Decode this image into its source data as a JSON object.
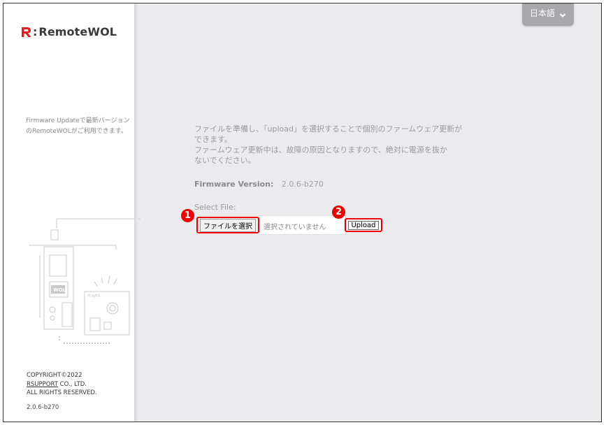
{
  "app": {
    "brand_name": "RemoteWOL"
  },
  "header": {
    "language_label": "日本語",
    "language_icon": "chevron-down-icon"
  },
  "sidebar": {
    "description": "Firmware Updateで最新バージョンのRemoteWOLがご利用できます。",
    "copyright_line1": "COPYRIGHT©2022",
    "copyright_company": "RSUPPORT",
    "copyright_company_suffix": " CO., LTD.",
    "copyright_line3": "ALL RIGHTS RESERVED.",
    "version": "2.0.6-b270"
  },
  "main": {
    "description_line1": "ファイルを準備し、「upload」を選択することで個別のファームウェア更新が",
    "description_line2": "できます。",
    "description_line3": "ファームウェア更新中は、故障の原因となりますので、絶対に電源を抜か",
    "description_line4": "ないでください。",
    "firmware_version_label": "Firmware Version:",
    "firmware_version_value": "2.0.6-b270",
    "select_file_label": "Select File:",
    "choose_file_button": "ファイルを選択",
    "file_status": "選択されていません",
    "upload_button": "Upload"
  },
  "annotations": {
    "badge1": "1",
    "badge2": "2",
    "color": "#e00000"
  },
  "colors": {
    "logo_red": "#e02020",
    "background": "#ebebed",
    "sidebar": "#ffffff"
  }
}
